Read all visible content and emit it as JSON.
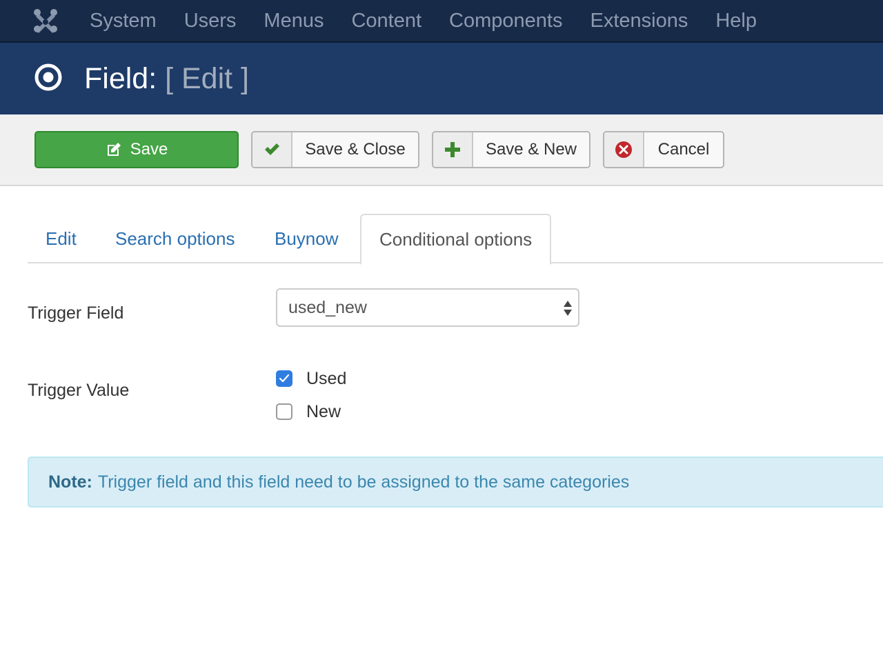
{
  "nav": {
    "logo_icon": "joomla-logo-icon",
    "items": [
      "System",
      "Users",
      "Menus",
      "Content",
      "Components",
      "Extensions",
      "Help"
    ]
  },
  "header": {
    "icon": "target-icon",
    "title": "Field:",
    "subtitle": "[ Edit ]"
  },
  "toolbar": {
    "save_label": "Save",
    "save_close_label": "Save & Close",
    "save_new_label": "Save & New",
    "cancel_label": "Cancel"
  },
  "tabs": [
    {
      "label": "Edit",
      "active": false
    },
    {
      "label": "Search options",
      "active": false
    },
    {
      "label": "Buynow",
      "active": false
    },
    {
      "label": "Conditional options",
      "active": true
    }
  ],
  "form": {
    "trigger_field_label": "Trigger Field",
    "trigger_field_value": "used_new",
    "trigger_value_label": "Trigger Value",
    "options": [
      {
        "label": "Used",
        "checked": true
      },
      {
        "label": "New",
        "checked": false
      }
    ]
  },
  "note": {
    "prefix": "Note:",
    "text": "Trigger field and this field need to be assigned to the same categories"
  },
  "colors": {
    "nav_bg": "#172a48",
    "header_bg": "#1e3a67",
    "save_green": "#46a546",
    "link_blue": "#2a6fb0",
    "note_bg": "#d9edf7"
  }
}
